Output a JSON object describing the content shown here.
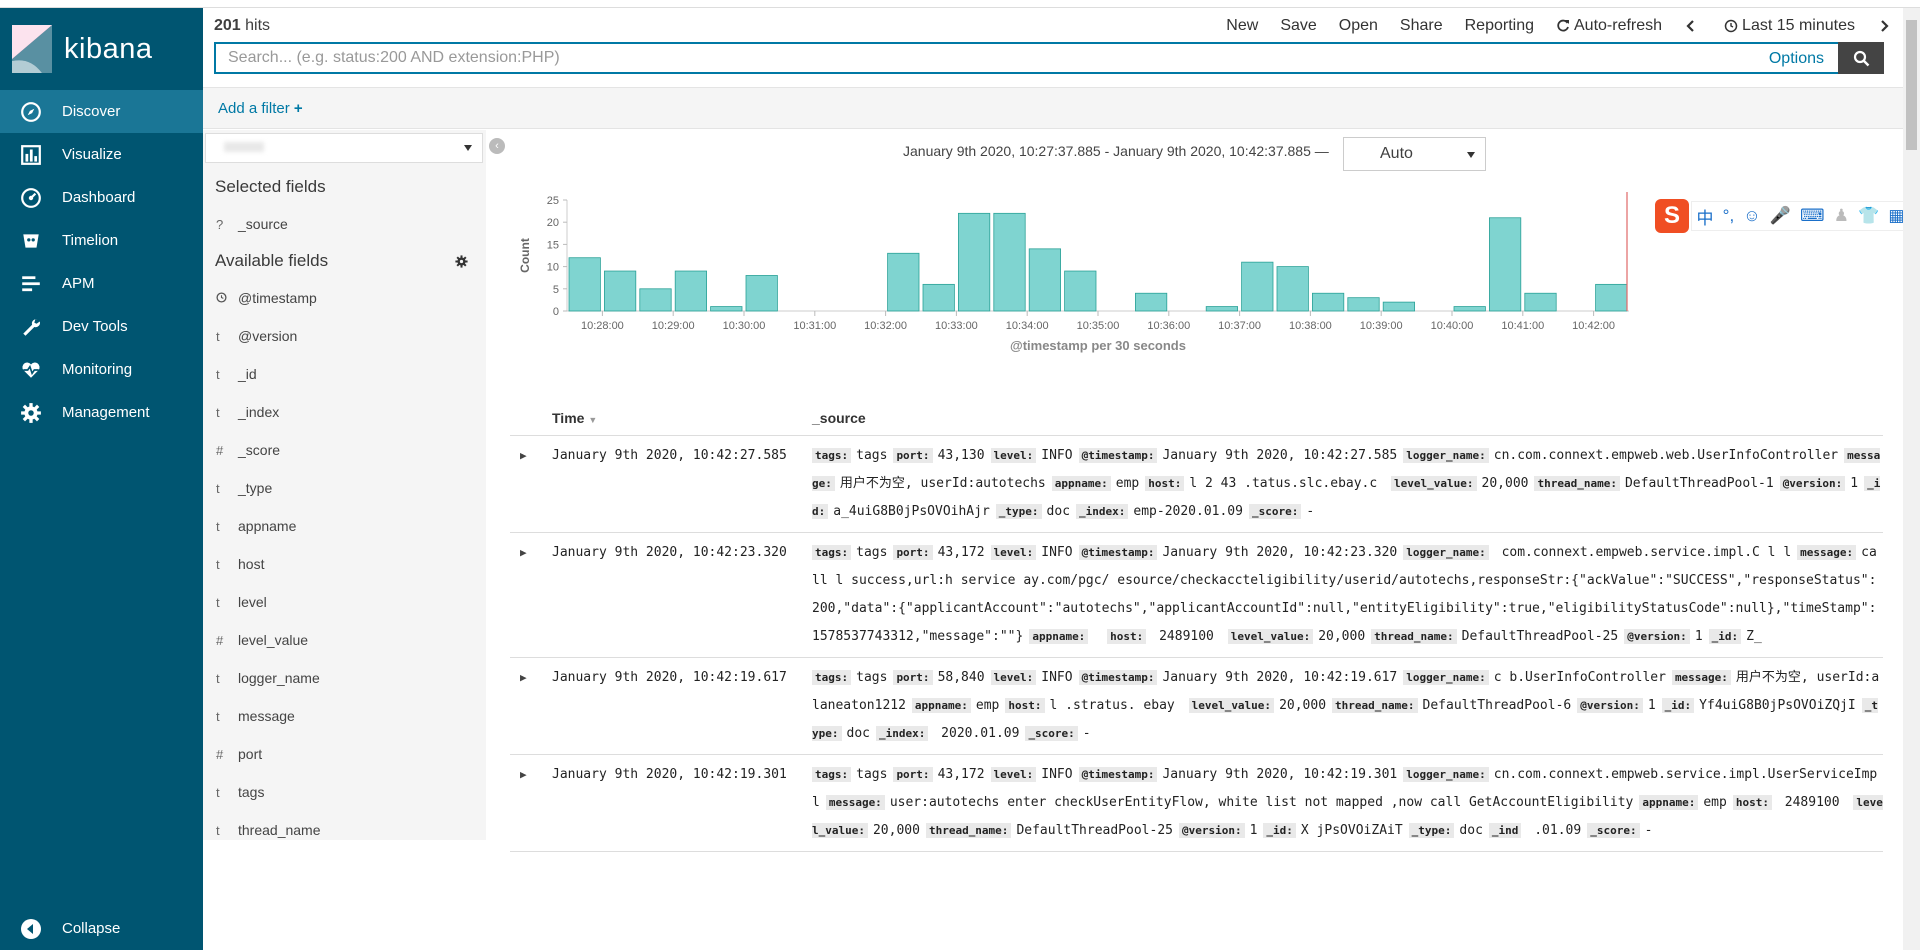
{
  "app": {
    "logo_text": "kibana",
    "nav": [
      {
        "label": "Discover",
        "icon": "compass-icon"
      },
      {
        "label": "Visualize",
        "icon": "bar-chart-icon"
      },
      {
        "label": "Dashboard",
        "icon": "dashboard-icon"
      },
      {
        "label": "Timelion",
        "icon": "timelion-icon"
      },
      {
        "label": "APM",
        "icon": "apm-icon"
      },
      {
        "label": "Dev Tools",
        "icon": "wrench-icon"
      },
      {
        "label": "Monitoring",
        "icon": "heartbeat-icon"
      },
      {
        "label": "Management",
        "icon": "gear-icon"
      }
    ],
    "collapse_label": "Collapse"
  },
  "header": {
    "hits_count": "201",
    "hits_label": "hits",
    "menu": {
      "new": "New",
      "save": "Save",
      "open": "Open",
      "share": "Share",
      "reporting": "Reporting",
      "auto_refresh": "Auto-refresh",
      "time_picker": "Last 15 minutes"
    }
  },
  "search": {
    "placeholder": "Search... (e.g. status:200 AND extension:PHP)",
    "options_label": "Options"
  },
  "filters": {
    "add_filter_label": "Add a filter"
  },
  "fields_panel": {
    "selected_heading": "Selected fields",
    "selected_fields": [
      {
        "type": "?",
        "name": "_source"
      }
    ],
    "available_heading": "Available fields",
    "available_fields": [
      {
        "type": "clock",
        "name": "@timestamp"
      },
      {
        "type": "t",
        "name": "@version"
      },
      {
        "type": "t",
        "name": "_id"
      },
      {
        "type": "t",
        "name": "_index"
      },
      {
        "type": "#",
        "name": "_score"
      },
      {
        "type": "t",
        "name": "_type"
      },
      {
        "type": "t",
        "name": "appname"
      },
      {
        "type": "t",
        "name": "host"
      },
      {
        "type": "t",
        "name": "level"
      },
      {
        "type": "#",
        "name": "level_value"
      },
      {
        "type": "t",
        "name": "logger_name"
      },
      {
        "type": "t",
        "name": "message"
      },
      {
        "type": "#",
        "name": "port"
      },
      {
        "type": "t",
        "name": "tags"
      },
      {
        "type": "t",
        "name": "thread_name"
      }
    ]
  },
  "chart": {
    "time_range": "January 9th 2020, 10:27:37.885 - January 9th 2020, 10:42:37.885 —",
    "interval": "Auto"
  },
  "chart_data": {
    "type": "bar",
    "ylabel": "Count",
    "xlabel": "@timestamp per 30 seconds",
    "ylim": [
      0,
      25
    ],
    "yticks": [
      0,
      5,
      10,
      15,
      20,
      25
    ],
    "xticks": [
      "10:28:00",
      "10:29:00",
      "10:30:00",
      "10:31:00",
      "10:32:00",
      "10:33:00",
      "10:34:00",
      "10:35:00",
      "10:36:00",
      "10:37:00",
      "10:38:00",
      "10:39:00",
      "10:40:00",
      "10:41:00",
      "10:42:00"
    ],
    "categories": [
      "10:27:30",
      "10:28:00",
      "10:28:30",
      "10:29:00",
      "10:29:30",
      "10:30:00",
      "10:30:30",
      "10:31:00",
      "10:31:30",
      "10:32:00",
      "10:32:30",
      "10:33:00",
      "10:33:30",
      "10:34:00",
      "10:34:30",
      "10:35:00",
      "10:35:30",
      "10:36:00",
      "10:36:30",
      "10:37:00",
      "10:37:30",
      "10:38:00",
      "10:38:30",
      "10:39:00",
      "10:39:30",
      "10:40:00",
      "10:40:30",
      "10:41:00",
      "10:41:30",
      "10:42:00"
    ],
    "values": [
      12,
      9,
      5,
      9,
      1,
      8,
      0,
      0,
      0,
      13,
      6,
      22,
      22,
      14,
      9,
      0,
      4,
      0,
      1,
      11,
      10,
      4,
      3,
      2,
      0,
      1,
      21,
      4,
      0,
      6
    ],
    "color": "#7fd4d0",
    "grid": false
  },
  "ime": {
    "logo": "S",
    "zh": "中"
  },
  "table": {
    "col_time": "Time",
    "col_source": "_source",
    "rows": [
      {
        "time": "January 9th 2020, 10:42:27.585",
        "fields": [
          {
            "k": "tags:",
            "v": "tags"
          },
          {
            "k": "port:",
            "v": "43,130"
          },
          {
            "k": "level:",
            "v": "INFO"
          },
          {
            "k": "@timestamp:",
            "v": "January 9th 2020, 10:42:27.585"
          },
          {
            "k": "logger_name:",
            "v": "cn.com.connext.empweb.web.UserInfoController"
          },
          {
            "k": "message:",
            "v": "用户不为空, userId:autotechs"
          },
          {
            "k": "appname:",
            "v": "emp"
          },
          {
            "k": "host:",
            "v": "l    2    43   .tatus.slc.ebay.c    "
          },
          {
            "k": "level_value:",
            "v": "20,000"
          },
          {
            "k": "thread_name:",
            "v": "DefaultThreadPool-1"
          },
          {
            "k": "@version:",
            "v": "1"
          },
          {
            "k": "_id:",
            "v": "a_4uiG8B0jPsOVOihAjr"
          },
          {
            "k": "_type:",
            "v": "doc"
          },
          {
            "k": "_index:",
            "v": "emp-2020.01.09"
          },
          {
            "k": "_score:",
            "v": "-"
          }
        ]
      },
      {
        "time": "January 9th 2020, 10:42:23.320",
        "fields": [
          {
            "k": "tags:",
            "v": "tags"
          },
          {
            "k": "port:",
            "v": "43,172"
          },
          {
            "k": "level:",
            "v": "INFO"
          },
          {
            "k": "@timestamp:",
            "v": "January 9th 2020, 10:42:23.320"
          },
          {
            "k": "logger_name:",
            "v": "     com.connext.empweb.service.impl.C                   l   l"
          },
          {
            "k": "message:",
            "v": "call                                              l success,url:h              service    ay.com/pgc/        esource/checkaccteligibility/userid/autotechs,responseStr:{\"ackValue\":\"SUCCESS\",\"responseStatus\":200,\"data\":{\"applicantAccount\":\"autotechs\",\"applicantAccountId\":null,\"entityEligibility\":true,\"eligibilityStatusCode\":null},\"timeStamp\":1578537743312,\"message\":\"\"}"
          },
          {
            "k": "appname:",
            "v": "   "
          },
          {
            "k": "host:",
            "v": "        2489100         "
          },
          {
            "k": "level_value:",
            "v": "20,000"
          },
          {
            "k": "thread_name:",
            "v": "DefaultThreadPool-25"
          },
          {
            "k": "@version:",
            "v": "1"
          },
          {
            "k": "_id:",
            "v": "Z_"
          }
        ]
      },
      {
        "time": "January 9th 2020, 10:42:19.617",
        "fields": [
          {
            "k": "tags:",
            "v": "tags"
          },
          {
            "k": "port:",
            "v": "58,840"
          },
          {
            "k": "level:",
            "v": "INFO"
          },
          {
            "k": "@timestamp:",
            "v": "January 9th 2020, 10:42:19.617"
          },
          {
            "k": "logger_name:",
            "v": "c                        b.UserInfoController"
          },
          {
            "k": "message:",
            "v": "用户不为空, userId:alaneaton1212"
          },
          {
            "k": "appname:",
            "v": "emp"
          },
          {
            "k": "host:",
            "v": "l         .stratus.   ebay    "
          },
          {
            "k": "level_value:",
            "v": "20,000"
          },
          {
            "k": "thread_name:",
            "v": "DefaultThreadPool-6"
          },
          {
            "k": "@version:",
            "v": "1"
          },
          {
            "k": "_id:",
            "v": "Yf4uiG8B0jPsOVOiZQjI"
          },
          {
            "k": "_type:",
            "v": "doc"
          },
          {
            "k": "_index:",
            "v": "     2020.01.09"
          },
          {
            "k": "_score:",
            "v": "-"
          }
        ]
      },
      {
        "time": "January 9th 2020, 10:42:19.301",
        "fields": [
          {
            "k": "tags:",
            "v": "tags"
          },
          {
            "k": "port:",
            "v": "43,172"
          },
          {
            "k": "level:",
            "v": "INFO"
          },
          {
            "k": "@timestamp:",
            "v": "January 9th 2020, 10:42:19.301"
          },
          {
            "k": "logger_name:",
            "v": "cn.com.connext.empweb.service.impl.UserServiceImpl"
          },
          {
            "k": "message:",
            "v": "user:autotechs enter checkUserEntityFlow, white list not mapped ,now call GetAccountEligibility"
          },
          {
            "k": "appname:",
            "v": "emp"
          },
          {
            "k": "host:",
            "v": "       2489100              "
          },
          {
            "k": "level_value:",
            "v": "20,000"
          },
          {
            "k": "thread_name:",
            "v": "DefaultThreadPool-25"
          },
          {
            "k": "@version:",
            "v": "1"
          },
          {
            "k": "_id:",
            "v": "X         jPsOVOiZAiT"
          },
          {
            "k": "_type:",
            "v": "doc"
          },
          {
            "k": "_ind",
            "v": "          .01.09"
          },
          {
            "k": "_score:",
            "v": "-"
          }
        ]
      }
    ]
  }
}
